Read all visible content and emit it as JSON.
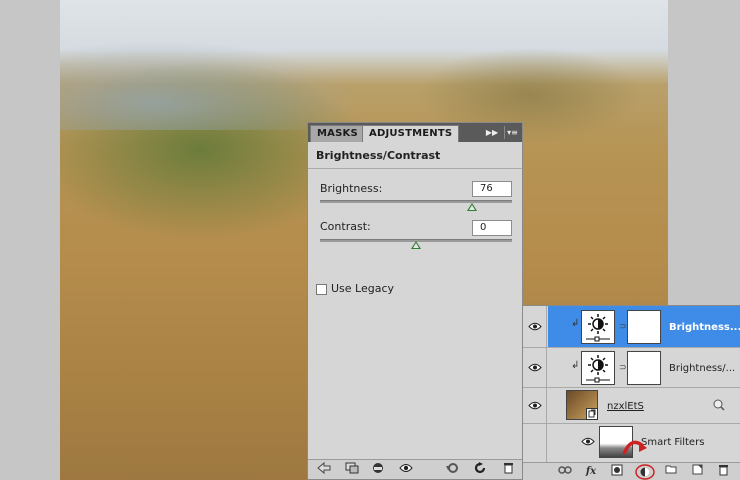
{
  "panel": {
    "tabs": [
      {
        "label": "MASKS",
        "active": false
      },
      {
        "label": "ADJUSTMENTS",
        "active": true
      }
    ],
    "title": "Brightness/Contrast",
    "brightness": {
      "label": "Brightness:",
      "value": "76",
      "slider_fraction": 0.79
    },
    "contrast": {
      "label": "Contrast:",
      "value": "0",
      "slider_fraction": 0.5
    },
    "use_legacy": {
      "label": "Use Legacy",
      "checked": false
    },
    "footer_icons": [
      "back-arrow-icon",
      "clip-to-layer-icon",
      "view-previous-icon",
      "visibility-icon",
      "reset-icon",
      "refresh-icon",
      "trash-icon"
    ]
  },
  "layers": [
    {
      "name": "Brightness...",
      "type": "adjustment",
      "selected": true,
      "visible": true
    },
    {
      "name": "Brightness/...",
      "type": "adjustment",
      "selected": false,
      "visible": true
    },
    {
      "name": "nzxlEtS",
      "type": "smart-object",
      "selected": false,
      "visible": true
    },
    {
      "name": "Smart Filters",
      "type": "smart-filters",
      "selected": false,
      "visible": true
    }
  ],
  "layers_footer_icons": [
    "link-icon",
    "fx-icon",
    "add-mask-icon",
    "new-adjustment-icon",
    "new-group-icon",
    "new-layer-icon",
    "trash-icon"
  ],
  "colors": {
    "selection": "#3f8ce8",
    "slider_thumb": "#2f7f2f",
    "highlight_circle": "#cc2222"
  }
}
